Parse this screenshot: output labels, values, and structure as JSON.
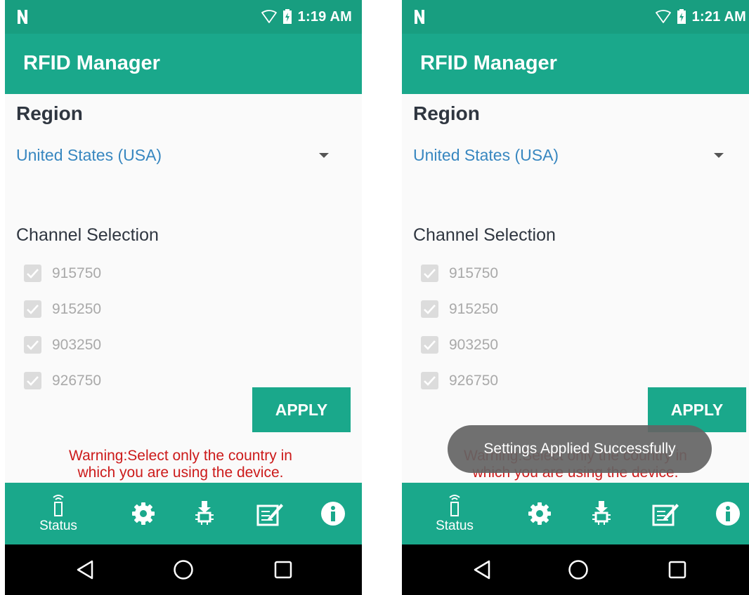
{
  "screens": [
    {
      "status_time": "1:19 AM",
      "app_title": "RFID Manager",
      "region_heading": "Region",
      "region_value": "United States (USA)",
      "channel_heading": "Channel Selection",
      "channels": [
        "915750",
        "915250",
        "903250",
        "926750"
      ],
      "apply_label": "APPLY",
      "warning": "Warning:Select only the country in which you are using the device.",
      "nav": {
        "status_label": "Status"
      }
    },
    {
      "status_time": "1:21 AM",
      "app_title": "RFID Manager",
      "region_heading": "Region",
      "region_value": "United States (USA)",
      "channel_heading": "Channel Selection",
      "channels": [
        "915750",
        "915250",
        "903250",
        "926750"
      ],
      "apply_label": "APPLY",
      "warning": "Warning:Select only the country in which you are using the device.",
      "nav": {
        "status_label": "Status"
      },
      "toast": "Settings Applied Successfully"
    }
  ],
  "icons": {
    "notification": "n-logo-icon",
    "wifi": "wifi-icon",
    "battery": "battery-charging-icon",
    "dropdown": "dropdown-arrow-icon",
    "checkbox": "checkbox-checked-icon",
    "nav": [
      "rfid-status-icon",
      "gear-icon",
      "firmware-update-icon",
      "edit-note-icon",
      "info-icon"
    ],
    "system": [
      "back-icon",
      "home-icon",
      "recents-icon"
    ]
  },
  "colors": {
    "statusbar": "#189e80",
    "appbar": "#1aa88b",
    "accent_text": "#3887c0",
    "warning_text": "#cc1a1a",
    "disabled_text": "#a9a9a9"
  }
}
